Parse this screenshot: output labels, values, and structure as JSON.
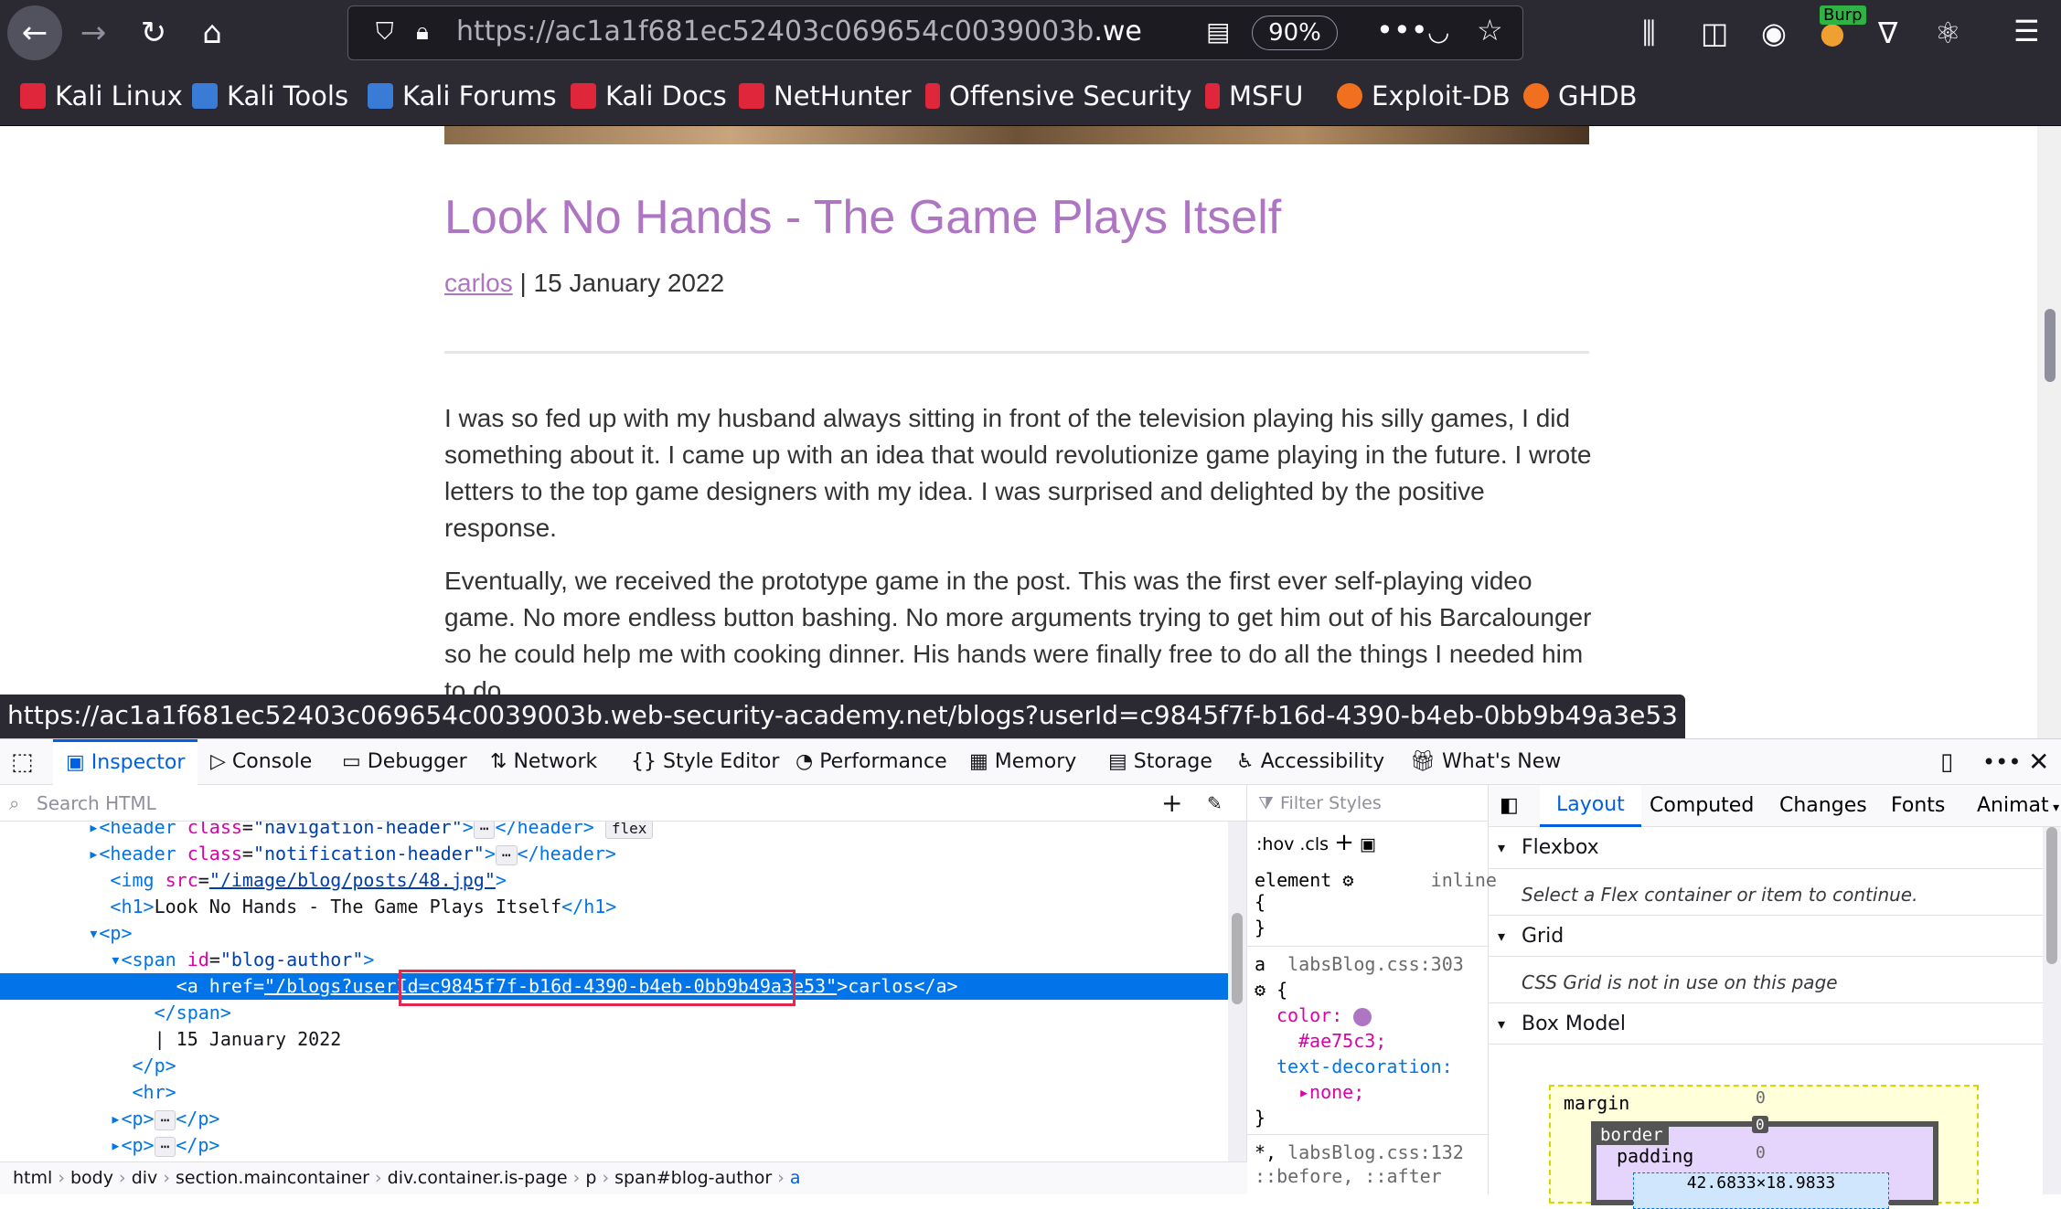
{
  "browser": {
    "url_prefix": "https://ac1a1f681ec52403c069654c0039003b",
    "url_domain": ".web-secur",
    "zoom": "90%",
    "burp_badge": "Burp"
  },
  "bookmarks": [
    {
      "label": "Kali Linux",
      "color": "#e0263a"
    },
    {
      "label": "Kali Tools",
      "color": "#3a7bd5"
    },
    {
      "label": "Kali Forums",
      "color": "#3a7bd5"
    },
    {
      "label": "Kali Docs",
      "color": "#e0263a"
    },
    {
      "label": "NetHunter",
      "color": "#e0263a"
    },
    {
      "label": "Offensive Security",
      "color": "#e0263a"
    },
    {
      "label": "MSFU",
      "color": "#e0263a"
    },
    {
      "label": "Exploit-DB",
      "color": "#f07020"
    },
    {
      "label": "GHDB",
      "color": "#f07020"
    }
  ],
  "post": {
    "title": "Look No Hands - The Game Plays Itself",
    "author": "carlos",
    "date_sep": " | 15 January 2022",
    "para1": "I was so fed up with my husband always sitting in front of the television playing his silly games, I did something about it. I came up with an idea that would revolutionize game playing in the future. I wrote letters to the top game designers with my idea. I was surprised and delighted by the positive response.",
    "para2": "Eventually, we received the prototype game in the post. This was the first ever self-playing video game. No more endless button bashing. No more arguments trying to get him out of his Barcalounger so he could help me with cooking dinner. His hands were finally free to do all the things I needed him to do."
  },
  "status_url": "https://ac1a1f681ec52403c069654c0039003b.web-security-academy.net/blogs?userId=c9845f7f-b16d-4390-b4eb-0bb9b49a3e53",
  "devtools": {
    "tabs": [
      "Inspector",
      "Console",
      "Debugger",
      "Network",
      "Style Editor",
      "Performance",
      "Memory",
      "Storage",
      "Accessibility",
      "What's New"
    ],
    "search_placeholder": "Search HTML",
    "filter_placeholder": "Filter Styles",
    "html_lines": [
      {
        "indent": 5,
        "text": "<header class=\"navigation-header\">…</header>",
        "extra": "flex"
      },
      {
        "indent": 5,
        "text": "<header class=\"notification-header\">…</header>",
        "extra": ""
      },
      {
        "indent": 6,
        "text": "<img src=\"/image/blog/posts/48.jpg\">",
        "extra": ""
      },
      {
        "indent": 6,
        "text": "<h1>Look No Hands - The Game Plays Itself</h1>",
        "extra": ""
      },
      {
        "indent": 5,
        "text": "<p>",
        "extra": ""
      },
      {
        "indent": 6,
        "text": "<span id=\"blog-author\">",
        "extra": ""
      },
      {
        "indent": 8,
        "text": "<a href=\"/blogs?userId=c9845f7f-b16d-4390-b4eb-0bb9b49a3e53\">carlos</a>",
        "extra": "",
        "selected": true
      },
      {
        "indent": 7,
        "text": "</span>",
        "extra": ""
      },
      {
        "indent": 7,
        "text": "| 15 January 2022",
        "extra": ""
      },
      {
        "indent": 6,
        "text": "</p>",
        "extra": ""
      },
      {
        "indent": 6,
        "text": "<hr>",
        "extra": ""
      },
      {
        "indent": 5,
        "text": "<p>…</p>",
        "extra": ""
      },
      {
        "indent": 5,
        "text": "<p>…</p>",
        "extra": ""
      }
    ],
    "breadcrumb": [
      "html",
      "body",
      "div",
      "section.maincontainer",
      "div.container.is-page",
      "p",
      "span#blog-author",
      "a"
    ],
    "rules": {
      "hov": ":hov",
      "cls": ".cls",
      "element_label": "element",
      "inline": "inline",
      "selector_a": "a",
      "source_a": "labsBlog.css:303",
      "color_prop": "color:",
      "color_val": "#ae75c3;",
      "textdec_prop": "text-decoration:",
      "textdec_val": "none;",
      "selector_star": "*,",
      "source_star": "labsBlog.css:132",
      "pseudo": "::before, ::after"
    },
    "layout_tabs": [
      "Layout",
      "Computed",
      "Changes",
      "Fonts",
      "Animat"
    ],
    "flexbox": "Flexbox",
    "flexbox_note": "Select a Flex container or item to continue.",
    "grid": "Grid",
    "grid_note": "CSS Grid is not in use on this page",
    "boxmodel": "Box Model",
    "bm_margin": "margin",
    "bm_border": "border",
    "bm_padding": "padding",
    "bm_zero": "0",
    "bm_size": "42.6833×18.9833"
  }
}
